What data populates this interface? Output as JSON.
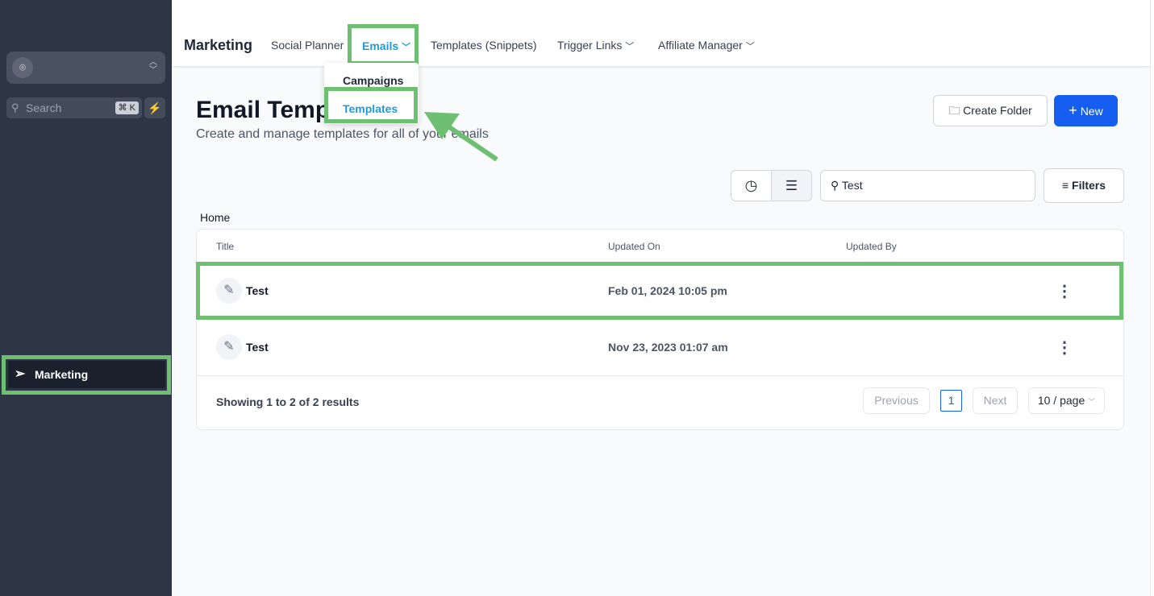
{
  "sidebar": {
    "search_placeholder": "Search",
    "shortcut": "⌘ K",
    "active_item": "Marketing"
  },
  "topnav": {
    "brand": "Marketing",
    "items": [
      "Social Planner",
      "Emails",
      "Templates (Snippets)",
      "Trigger Links",
      "Affiliate Manager"
    ],
    "dropdown": [
      "Campaigns",
      "Templates"
    ]
  },
  "page": {
    "title": "Email Templates",
    "subtitle": "Create and manage templates for all of your emails",
    "create_folder": "Create Folder",
    "new": "New",
    "search_value": "Test",
    "filters": "Filters",
    "breadcrumb": "Home"
  },
  "table": {
    "headers": [
      "Title",
      "Updated On",
      "Updated By"
    ],
    "rows": [
      {
        "title": "Test",
        "updated_on": "Feb 01, 2024 10:05 pm",
        "updated_by": ""
      },
      {
        "title": "Test",
        "updated_on": "Nov 23, 2023 01:07 am",
        "updated_by": ""
      }
    ]
  },
  "pagination": {
    "summary": "Showing 1 to 2 of 2 results",
    "previous": "Previous",
    "page": "1",
    "next": "Next",
    "per_page": "10 / page"
  },
  "colors": {
    "accent": "#155eef",
    "highlight": "#6fbf73",
    "sidebar": "#2e3646"
  }
}
